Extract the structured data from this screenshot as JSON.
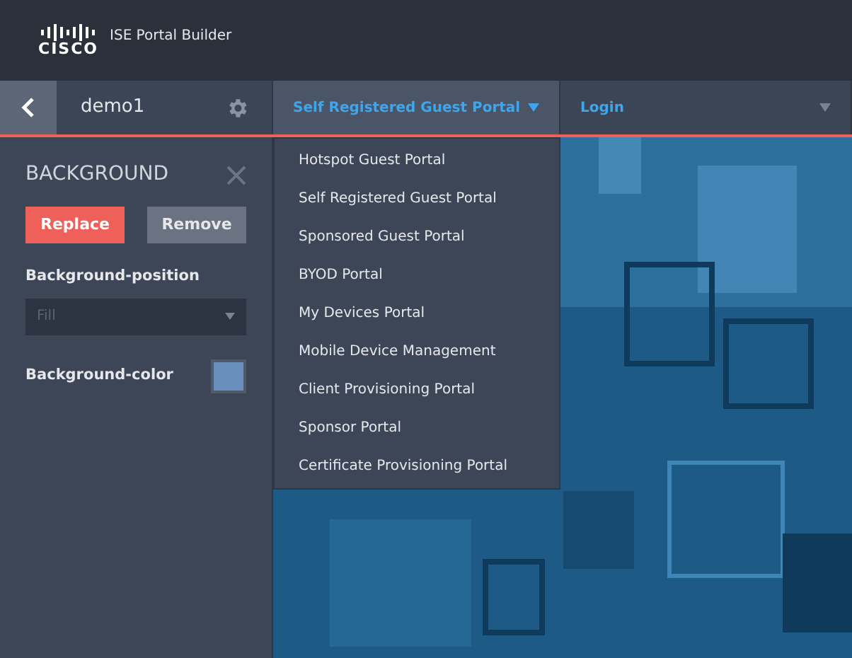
{
  "header": {
    "logo_text": "CISCO",
    "app_title": "ISE Portal Builder"
  },
  "toolbar": {
    "project_name": "demo1",
    "tabs": [
      {
        "label": "Self Registered Guest Portal",
        "expanded": true
      },
      {
        "label": "Login",
        "expanded": false
      }
    ]
  },
  "portal_menu": {
    "items": [
      "Hotspot Guest Portal",
      "Self Registered Guest Portal",
      "Sponsored Guest Portal",
      "BYOD Portal",
      "My Devices Portal",
      "Mobile Device Management",
      "Client Provisioning Portal",
      "Sponsor Portal",
      "Certificate Provisioning Portal"
    ]
  },
  "panel": {
    "title": "BACKGROUND",
    "buttons": [
      {
        "label": "Replace",
        "kind": "primary"
      },
      {
        "label": "Remove",
        "kind": "secondary"
      }
    ],
    "position_label": "Background-position",
    "position_value": "Fill",
    "position_disabled": true,
    "color_label": "Background-color",
    "color": "#6a8fbf"
  }
}
